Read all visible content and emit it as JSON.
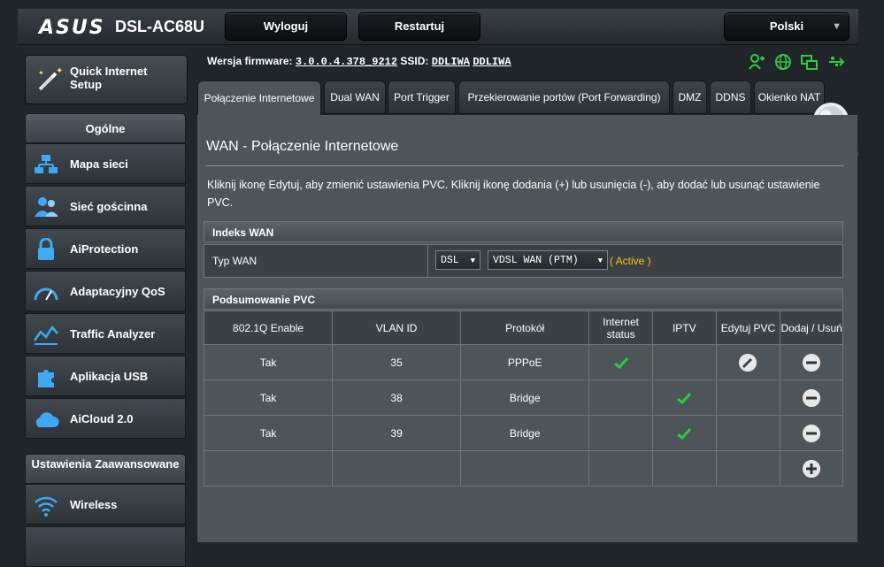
{
  "header": {
    "logo": "ASUS",
    "model": "DSL-AC68U",
    "logout": "Wyloguj",
    "restart": "Restartuj",
    "language": "Polski"
  },
  "sidebar": {
    "quick_setup": "Quick Internet Setup",
    "general_heading": "Ogólne",
    "items": [
      {
        "label": "Mapa sieci",
        "icon": "network-map-icon"
      },
      {
        "label": "Sieć gościnna",
        "icon": "guest-network-icon"
      },
      {
        "label": "AiProtection",
        "icon": "lock-icon"
      },
      {
        "label": "Adaptacyjny QoS",
        "icon": "speedometer-icon"
      },
      {
        "label": "Traffic Analyzer",
        "icon": "traffic-chart-icon"
      },
      {
        "label": "Aplikacja USB",
        "icon": "puzzle-icon"
      },
      {
        "label": "AiCloud 2.0",
        "icon": "cloud-icon"
      }
    ],
    "advanced_heading": "Ustawienia Zaawansowane",
    "advanced_items": [
      {
        "label": "Wireless",
        "icon": "wifi-icon"
      }
    ]
  },
  "firmware": {
    "label": "Wersja firmware:",
    "version": "3.0.0.4.378_9212",
    "ssid_label": "SSID:",
    "ssid1": "DDLIWA",
    "ssid2": "DDLIWA"
  },
  "tabs": [
    {
      "label": "Połączenie Internetowe"
    },
    {
      "label": "Dual WAN"
    },
    {
      "label": "Port Trigger"
    },
    {
      "label": "Przekierowanie portów (Port Forwarding)"
    },
    {
      "label": "DMZ"
    },
    {
      "label": "DDNS"
    },
    {
      "label": "Okienko NAT"
    }
  ],
  "page": {
    "title": "WAN - Połączenie Internetowe",
    "description": "Kliknij ikonę Edytuj, aby zmienić ustawienia PVC. Kliknij ikonę dodania (+) lub usunięcia (-), aby dodać lub usunąć ustawienie PVC.",
    "wan_index_heading": "Indeks WAN",
    "wan_type_label": "Typ WAN",
    "wan_type_value": "DSL",
    "wan_mode_value": "VDSL WAN (PTM)",
    "active_label": "( Active )",
    "pvc_heading": "Podsumowanie PVC"
  },
  "pvc_table": {
    "headers": [
      "802.1Q Enable",
      "VLAN ID",
      "Protokół",
      "Internet status",
      "IPTV",
      "Edytuj PVC",
      "Dodaj / Usuń"
    ],
    "rows": [
      {
        "enable": "Tak",
        "vlan": "35",
        "protocol": "PPPoE"
      },
      {
        "enable": "Tak",
        "vlan": "38",
        "protocol": "Bridge"
      },
      {
        "enable": "Tak",
        "vlan": "39",
        "protocol": "Bridge"
      }
    ]
  },
  "colors": {
    "accent_active": "#ffc107",
    "status_green": "#2ecc40",
    "panel": "#4d5559"
  }
}
